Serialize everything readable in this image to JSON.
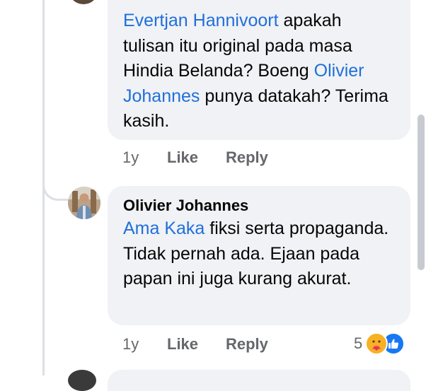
{
  "comment1": {
    "text_parts": [
      {
        "text": "Evertjan Hannivoort",
        "mention": true
      },
      {
        "text": " apakah tulisan itu original pada masa Hindia Belanda? Boeng ",
        "mention": false
      },
      {
        "text": "Olivier Johannes",
        "mention": true
      },
      {
        "text": " punya datakah? Terima kasih.",
        "mention": false
      }
    ],
    "time": "1y",
    "like_label": "Like",
    "reply_label": "Reply"
  },
  "comment2": {
    "author": "Olivier Johannes",
    "text_parts": [
      {
        "text": "Ama Kaka",
        "mention": true
      },
      {
        "text": " fiksi serta propaganda. Tidak pernah ada. Ejaan pada papan ini juga kurang akurat.",
        "mention": false
      }
    ],
    "time": "1y",
    "like_label": "Like",
    "reply_label": "Reply",
    "reaction_count": "5",
    "reaction_icons": [
      "care-emoji-icon",
      "thumbs-up-icon"
    ]
  },
  "colors": {
    "mention": "#216fdb",
    "bubble": "#f0f2f5",
    "meta": "#65676b",
    "like_blue": "#1877f2",
    "care_yellow": "#f7b125"
  }
}
